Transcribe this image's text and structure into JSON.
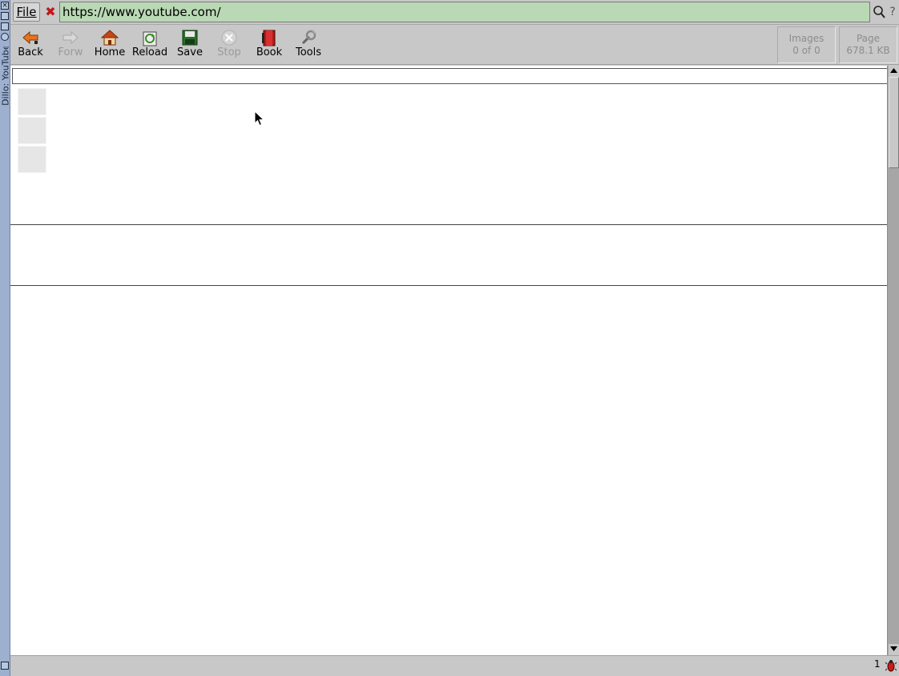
{
  "window": {
    "title": "Dillo: YouTube",
    "buttons": [
      "close-icon",
      "maximize-icon",
      "minimize-icon"
    ]
  },
  "locbar": {
    "file_menu": "File",
    "url": "https://www.youtube.com/"
  },
  "toolbar": {
    "buttons": [
      {
        "name": "back",
        "label": "Back",
        "icon": "back-arrow-icon",
        "enabled": true
      },
      {
        "name": "forward",
        "label": "Forw",
        "icon": "forward-arrow-icon",
        "enabled": false
      },
      {
        "name": "home",
        "label": "Home",
        "icon": "home-icon",
        "enabled": true
      },
      {
        "name": "reload",
        "label": "Reload",
        "icon": "reload-icon",
        "enabled": true
      },
      {
        "name": "save",
        "label": "Save",
        "icon": "save-icon",
        "enabled": true
      },
      {
        "name": "stop",
        "label": "Stop",
        "icon": "stop-icon",
        "enabled": false
      },
      {
        "name": "book",
        "label": "Book",
        "icon": "bookmark-icon",
        "enabled": true
      },
      {
        "name": "tools",
        "label": "Tools",
        "icon": "tools-icon",
        "enabled": true
      }
    ],
    "images_label": "Images",
    "images_value": "0 of 0",
    "page_label": "Page",
    "page_value": "678.1 KB"
  },
  "status": {
    "text": "",
    "count": "1"
  },
  "colors": {
    "url_bg": "#b9d8b4",
    "chrome": "#c8c8c8",
    "wm_strip": "#9db0cf"
  }
}
